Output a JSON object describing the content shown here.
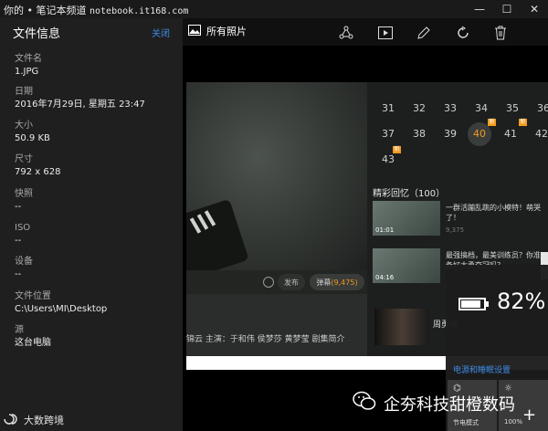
{
  "watermark": {
    "top_prefix": "你的 • 笔记本频道",
    "top_domain": "notebook.it168.com",
    "bottom_wechat": "企夯科技甜橙数码",
    "bottom_left": "大数跨境"
  },
  "window_controls": {
    "minimize": "—",
    "maximize": "☐",
    "close": "✕"
  },
  "panel": {
    "title": "文件信息",
    "close_label": "关闭",
    "fields": [
      {
        "label": "文件名",
        "value": "1.JPG"
      },
      {
        "label": "日期",
        "value": "2016年7月29日, 星期五 23:47"
      },
      {
        "label": "大小",
        "value": "50.9 KB"
      },
      {
        "label": "尺寸",
        "value": "792 x 628"
      },
      {
        "label": "快照",
        "value": "--"
      },
      {
        "label": "ISO",
        "value": "--"
      },
      {
        "label": "设备",
        "value": "--"
      },
      {
        "label": "文件位置",
        "value": "C:\\Users\\MI\\Desktop"
      },
      {
        "label": "源",
        "value": "这台电脑"
      }
    ]
  },
  "toolbar": {
    "all_photos_label": "所有照片",
    "icons": [
      "share-icon",
      "slideshow-icon",
      "edit-icon",
      "rotate-icon",
      "delete-icon"
    ]
  },
  "photo": {
    "send_label": "发布",
    "danmu_label": "弹幕",
    "danmu_count": "(9,475)",
    "meta_line": "锦云  主演：于和伟 侯梦莎 黄梦莹 剧集简介",
    "episodes": [
      "31",
      "32",
      "33",
      "34",
      "35",
      "36",
      "37",
      "38",
      "39",
      "40",
      "41",
      "42",
      "43"
    ],
    "active_episode": "40",
    "highlights_title": "精彩回忆（100）",
    "clips": [
      {
        "duration": "01:01",
        "title": "一群活蹦乱跳的小模特！萌哭了！",
        "meta": "9,375"
      },
      {
        "duration": "04:16",
        "title": "最强搞档，最美训练员？你准备好大勇夺冠吗？",
        "meta": ""
      }
    ],
    "poster_text": "周勇讯",
    "badge": "新"
  },
  "flyout": {
    "battery_percent": 82,
    "battery_text": "82%",
    "settings_link": "电源和睡眠设置",
    "tiles": [
      {
        "icon": "battery-saver-icon",
        "label": "节电模式"
      },
      {
        "icon": "brightness-icon",
        "label": "100%"
      }
    ]
  }
}
